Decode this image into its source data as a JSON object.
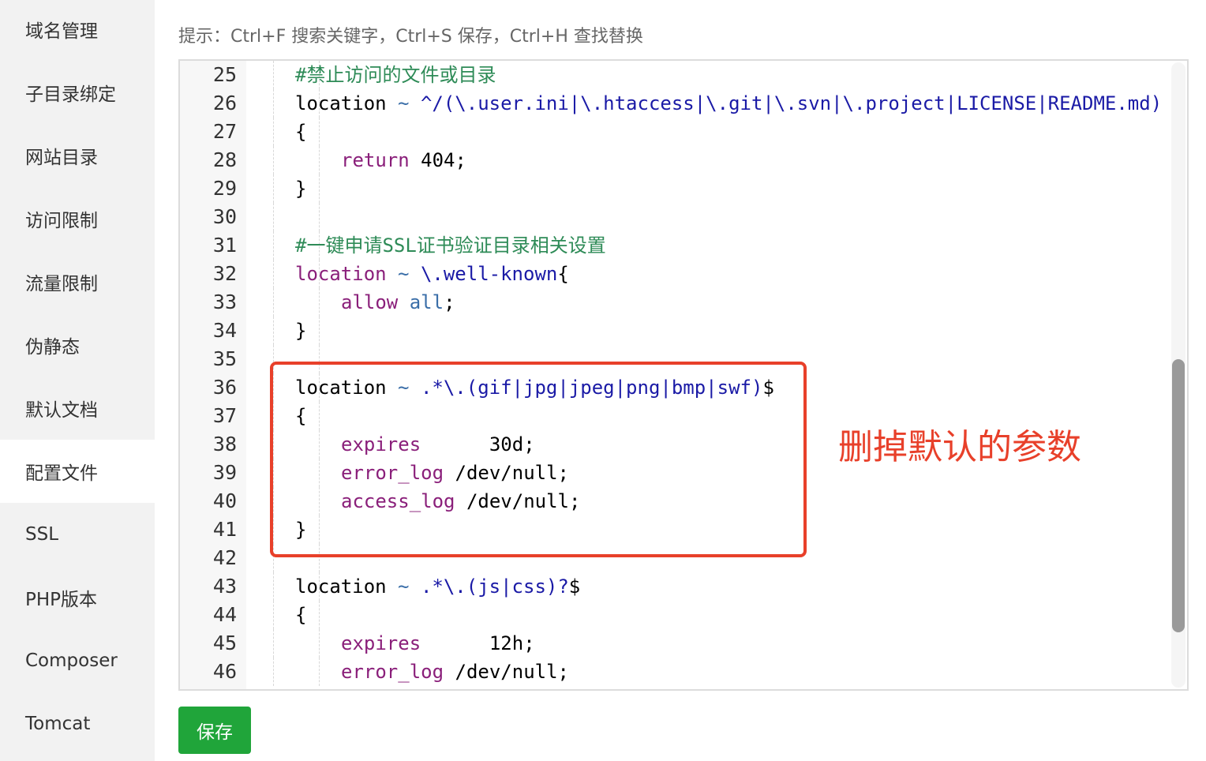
{
  "sidebar": {
    "items": [
      {
        "label": "域名管理",
        "active": false
      },
      {
        "label": "子目录绑定",
        "active": false
      },
      {
        "label": "网站目录",
        "active": false
      },
      {
        "label": "访问限制",
        "active": false
      },
      {
        "label": "流量限制",
        "active": false
      },
      {
        "label": "伪静态",
        "active": false
      },
      {
        "label": "默认文档",
        "active": false
      },
      {
        "label": "配置文件",
        "active": true
      },
      {
        "label": "SSL",
        "active": false
      },
      {
        "label": "PHP版本",
        "active": false
      },
      {
        "label": "Composer",
        "active": false
      },
      {
        "label": "Tomcat",
        "active": false
      }
    ]
  },
  "hint": "提示：Ctrl+F 搜索关键字，Ctrl+S 保存，Ctrl+H 查找替换",
  "editor": {
    "lines": [
      {
        "num": "25",
        "indent": 1,
        "tokens": [
          {
            "t": "#禁止访问的文件或目录",
            "c": "comment"
          }
        ]
      },
      {
        "num": "26",
        "indent": 1,
        "tokens": [
          {
            "t": "location",
            "c": "plain"
          },
          {
            "t": " ~ ",
            "c": "op"
          },
          {
            "t": "^/(\\.user.ini|\\.htaccess|\\.git|\\.svn|\\.project|LICENSE|README.md)",
            "c": "str"
          }
        ]
      },
      {
        "num": "27",
        "indent": 1,
        "tokens": [
          {
            "t": "{",
            "c": "plain"
          }
        ]
      },
      {
        "num": "28",
        "indent": 2,
        "tokens": [
          {
            "t": "return",
            "c": "kw"
          },
          {
            "t": " 404;",
            "c": "plain"
          }
        ]
      },
      {
        "num": "29",
        "indent": 1,
        "tokens": [
          {
            "t": "}",
            "c": "plain"
          }
        ]
      },
      {
        "num": "30",
        "indent": 0,
        "tokens": []
      },
      {
        "num": "31",
        "indent": 1,
        "tokens": [
          {
            "t": "#一键申请SSL证书验证目录相关设置",
            "c": "comment"
          }
        ]
      },
      {
        "num": "32",
        "indent": 1,
        "tokens": [
          {
            "t": "location",
            "c": "kw"
          },
          {
            "t": " ~ ",
            "c": "op"
          },
          {
            "t": "\\.well-known",
            "c": "str"
          },
          {
            "t": "{",
            "c": "plain"
          }
        ]
      },
      {
        "num": "33",
        "indent": 2,
        "tokens": [
          {
            "t": "allow",
            "c": "kw"
          },
          {
            "t": " ",
            "c": "plain"
          },
          {
            "t": "all",
            "c": "op"
          },
          {
            "t": ";",
            "c": "plain"
          }
        ]
      },
      {
        "num": "34",
        "indent": 1,
        "tokens": [
          {
            "t": "}",
            "c": "plain"
          }
        ]
      },
      {
        "num": "35",
        "indent": 0,
        "tokens": []
      },
      {
        "num": "36",
        "indent": 1,
        "tokens": [
          {
            "t": "location",
            "c": "plain"
          },
          {
            "t": " ~ ",
            "c": "op"
          },
          {
            "t": ".*\\.(gif|jpg|jpeg|png|bmp|swf)",
            "c": "str"
          },
          {
            "t": "$",
            "c": "plain"
          }
        ]
      },
      {
        "num": "37",
        "indent": 1,
        "tokens": [
          {
            "t": "{",
            "c": "plain"
          }
        ]
      },
      {
        "num": "38",
        "indent": 2,
        "tokens": [
          {
            "t": "expires",
            "c": "kw"
          },
          {
            "t": "      30d;",
            "c": "plain"
          }
        ]
      },
      {
        "num": "39",
        "indent": 2,
        "tokens": [
          {
            "t": "error_log",
            "c": "kw"
          },
          {
            "t": " /dev/null;",
            "c": "plain"
          }
        ]
      },
      {
        "num": "40",
        "indent": 2,
        "tokens": [
          {
            "t": "access_log",
            "c": "kw"
          },
          {
            "t": " /dev/null;",
            "c": "plain"
          }
        ]
      },
      {
        "num": "41",
        "indent": 1,
        "tokens": [
          {
            "t": "}",
            "c": "plain"
          }
        ]
      },
      {
        "num": "42",
        "indent": 0,
        "tokens": []
      },
      {
        "num": "43",
        "indent": 1,
        "tokens": [
          {
            "t": "location",
            "c": "plain"
          },
          {
            "t": " ~ ",
            "c": "op"
          },
          {
            "t": ".*\\.(js|css)?",
            "c": "str"
          },
          {
            "t": "$",
            "c": "plain"
          }
        ]
      },
      {
        "num": "44",
        "indent": 1,
        "tokens": [
          {
            "t": "{",
            "c": "plain"
          }
        ]
      },
      {
        "num": "45",
        "indent": 2,
        "tokens": [
          {
            "t": "expires",
            "c": "kw"
          },
          {
            "t": "      12h;",
            "c": "plain"
          }
        ]
      },
      {
        "num": "46",
        "indent": 2,
        "tokens": [
          {
            "t": "error_log",
            "c": "kw"
          },
          {
            "t": " /dev/null;",
            "c": "plain"
          }
        ]
      }
    ]
  },
  "annotation": "删掉默认的参数",
  "save_button_label": "保存",
  "colors": {
    "accent_green": "#20a53a",
    "annotation_red": "#e8402a",
    "comment": "#2e8b57",
    "keyword": "#8a1f7a",
    "string": "#1a1aa6"
  }
}
